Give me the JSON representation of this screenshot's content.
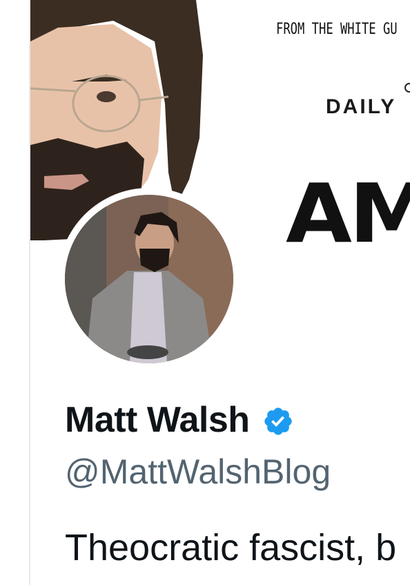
{
  "profile": {
    "display_name": "Matt Walsh",
    "handle": "@MattWalshBlog",
    "bio": "Theocratic fascist, b",
    "verified_icon": "verified-badge-icon",
    "verified_color": "#1d9bf0"
  },
  "banner": {
    "caption": "FROM THE WHITE GU",
    "brand": "DAILY",
    "title_fragment": "AM"
  },
  "colors": {
    "name": "#0f1419",
    "handle": "#536471",
    "accent": "#1d9bf0"
  }
}
